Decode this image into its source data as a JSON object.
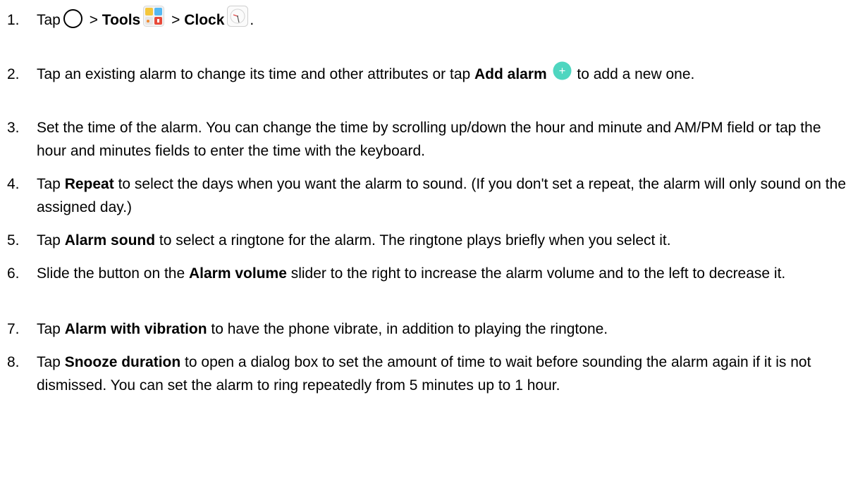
{
  "steps": [
    {
      "num": "1.",
      "a": "Tap",
      "b": " > ",
      "c": "Tools",
      "d": " > ",
      "e": "Clock",
      "f": "."
    },
    {
      "num": "2.",
      "a": "Tap an existing alarm to change its time and other attributes or tap ",
      "b": "Add alarm",
      "c": " to add a new one."
    },
    {
      "num": "3.",
      "a": "Set the time of the alarm. You can change the time by scrolling up/down the hour and minute and AM/PM field or tap the hour and minutes fields to enter the time with the keyboard."
    },
    {
      "num": "4.",
      "a": "Tap ",
      "b": "Repeat",
      "c": " to select the days when you want the alarm to sound. (If you don't set a repeat, the alarm will only sound on the assigned day.)"
    },
    {
      "num": "5.",
      "a": "Tap ",
      "b": "Alarm sound",
      "c": " to select a ringtone for the alarm. The ringtone plays briefly when you select it."
    },
    {
      "num": "6.",
      "a": "Slide the button on the ",
      "b": "Alarm volume",
      "c": " slider to the right to increase the alarm volume and to the left to decrease it."
    },
    {
      "num": "7.",
      "a": "Tap ",
      "b": "Alarm with vibration",
      "c": " to have the phone vibrate, in addition to playing the ringtone."
    },
    {
      "num": "8.",
      "a": "Tap ",
      "b": "Snooze duration",
      "c": " to open a dialog box to set the amount of time to wait before sounding the alarm again if it is not dismissed. You can set the alarm to ring repeatedly from 5 minutes up to 1 hour."
    }
  ],
  "icons": {
    "home": "home-circle-icon",
    "tools": "tools-folder-icon",
    "clock": "clock-app-icon",
    "add": "add-alarm-plus-icon"
  },
  "colors": {
    "add_icon": "#4fd6c0",
    "tools_blue": "#55b8f2",
    "tools_red": "#e84a3a",
    "tools_yellow": "#f4c63b"
  }
}
